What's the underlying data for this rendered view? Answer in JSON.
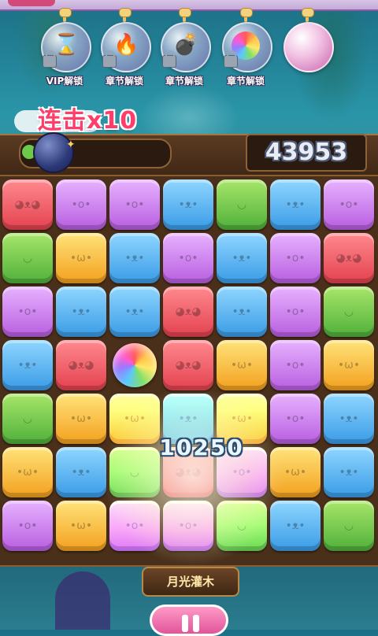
{
  "powerups": [
    {
      "label": "VIP解锁",
      "icon": "hourglass-icon",
      "glyph": "⌛",
      "locked": true
    },
    {
      "label": "章节解锁",
      "icon": "fire-icon",
      "glyph": "🔥",
      "locked": true
    },
    {
      "label": "章节解锁",
      "icon": "bomb-icon",
      "glyph": "💣",
      "locked": true
    },
    {
      "label": "章节解锁",
      "icon": "rainbow-ball-icon",
      "glyph": "●",
      "locked": true
    },
    {
      "label": "",
      "icon": "empty-bubble-icon",
      "glyph": "",
      "locked": false
    }
  ],
  "combo": "连击x10",
  "score": "43953",
  "points_popup": "10250",
  "chapter": "月光灌木",
  "board": [
    [
      "red",
      "purple",
      "purple",
      "blue",
      "green",
      "blue",
      "purple"
    ],
    [
      "green",
      "yellow",
      "blue",
      "purple",
      "blue",
      "purple",
      "red"
    ],
    [
      "purple",
      "blue",
      "blue",
      "red",
      "blue",
      "purple",
      "green"
    ],
    [
      "blue",
      "red",
      "rainbow",
      "red",
      "yellow",
      "purple",
      "yellow"
    ],
    [
      "green",
      "yellow",
      "yellow",
      "blue",
      "yellow",
      "purple",
      "blue"
    ],
    [
      "yellow",
      "blue",
      "green",
      "red",
      "purple",
      "yellow",
      "blue"
    ],
    [
      "purple",
      "yellow",
      "purple",
      "purple",
      "green",
      "blue",
      "green"
    ]
  ],
  "colors": {
    "red": "#e3414f",
    "purple": "#b85ee0",
    "blue": "#3a9be6",
    "green": "#4fb03a",
    "yellow": "#f3a01e",
    "accent_pink": "#ff3d6a"
  }
}
